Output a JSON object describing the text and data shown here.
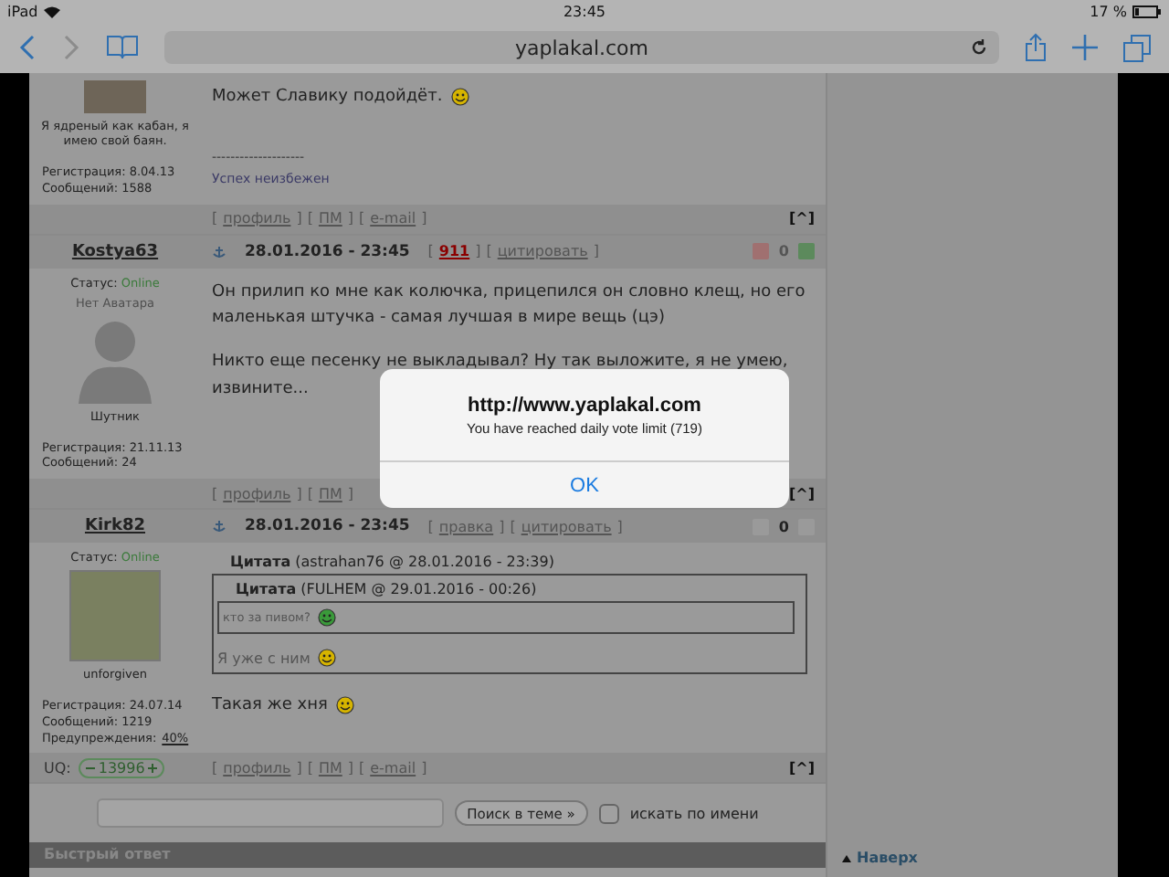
{
  "status_bar": {
    "device": "iPad",
    "time": "23:45",
    "battery": "17 %"
  },
  "browser": {
    "url": "yaplakal.com"
  },
  "posts": [
    {
      "kind": "partial",
      "title": "Я ядреный как кабан, я имею свой баян.",
      "registration": "Регистрация: 8.04.13",
      "messages": "Сообщений: 1588",
      "body": [
        {
          "kind": "text",
          "text": "Может Славику подойдёт.",
          "smiley": true
        }
      ],
      "signature_rule": "--------------------",
      "signature": "Успех неизбежен",
      "links": [
        {
          "before": "[",
          "label": "профиль",
          "after": "]"
        },
        {
          "before": "[",
          "label": "ПМ",
          "after": "]"
        },
        {
          "before": "[",
          "label": "e-mail",
          "after": "]"
        }
      ],
      "top": "[^]"
    },
    {
      "kind": "full",
      "author": "Kostya63",
      "status_label": "Статус:",
      "status": "Online",
      "no_avatar": "Нет Аватара",
      "rank": "Шутник",
      "registration": "Регистрация: 21.11.13",
      "messages": "Сообщений: 24",
      "date": "28.01.2016 - 23:45",
      "actions": [
        {
          "kind": "count",
          "before": "[",
          "label": "911",
          "after": "]"
        },
        {
          "kind": "link",
          "before": "[",
          "label": "цитировать",
          "after": "]"
        }
      ],
      "vote": {
        "score": "0",
        "enabled": true
      },
      "body": [
        {
          "kind": "text",
          "text": "Он прилип ко мне как колючка, прицепился он словно клещ, но его маленькая штучка - самая лучшая в мире вещь (цэ)"
        },
        {
          "kind": "text",
          "text": "Никто еще песенку не выкладывал? Ну так выложите, я не умею, извините..."
        }
      ],
      "links": [
        {
          "before": "[",
          "label": "профиль",
          "after": "]"
        },
        {
          "before": "[",
          "label": "ПМ",
          "after": "]"
        }
      ],
      "top": "[^]"
    },
    {
      "kind": "full",
      "author": "Kirk82",
      "status_label": "Статус:",
      "status": "Online",
      "avatar": true,
      "rank": "unforgiven",
      "registration": "Регистрация: 24.07.14",
      "messages": "Сообщений: 1219",
      "warnings": {
        "label": "Предупреждения:",
        "value": "40%"
      },
      "date": "28.01.2016 - 23:45",
      "actions": [
        {
          "kind": "link",
          "before": "[",
          "label": "правка",
          "after": "]"
        },
        {
          "kind": "link",
          "before": "[",
          "label": "цитировать",
          "after": "]"
        }
      ],
      "vote": {
        "score": "0",
        "enabled": false
      },
      "body": [
        {
          "kind": "quote",
          "title": "**Цитата** (astrahan76 @ 28.01.2016 - 23:39)",
          "blocks": [
            {
              "kind": "quote",
              "title": "**Цитата** (FULHEM @ 29.01.2016 - 00:26)",
              "blocks": [
                {
                  "kind": "small",
                  "text": "кто за пивом?",
                  "smiley": true
                }
              ]
            },
            {
              "kind": "faded",
              "text": "Я уже с ним",
              "smiley": true
            }
          ]
        },
        {
          "kind": "text",
          "text": "Такая же хня",
          "smiley": true
        }
      ],
      "uq": {
        "label": "UQ:",
        "value": "13996"
      },
      "links": [
        {
          "before": "[",
          "label": "профиль",
          "after": "]"
        },
        {
          "before": "[",
          "label": "ПМ",
          "after": "]"
        },
        {
          "before": "[",
          "label": "e-mail",
          "after": "]"
        }
      ],
      "top": "[^]"
    }
  ],
  "search": {
    "button": "Поиск в теме »",
    "checkbox_label": "искать по имени",
    "checked": false
  },
  "quick_reply": "Быстрый ответ",
  "to_top": "Наверх",
  "alert": {
    "title": "http://www.yaplakal.com",
    "message": "You have reached daily vote limit (719)",
    "button": "OK"
  }
}
